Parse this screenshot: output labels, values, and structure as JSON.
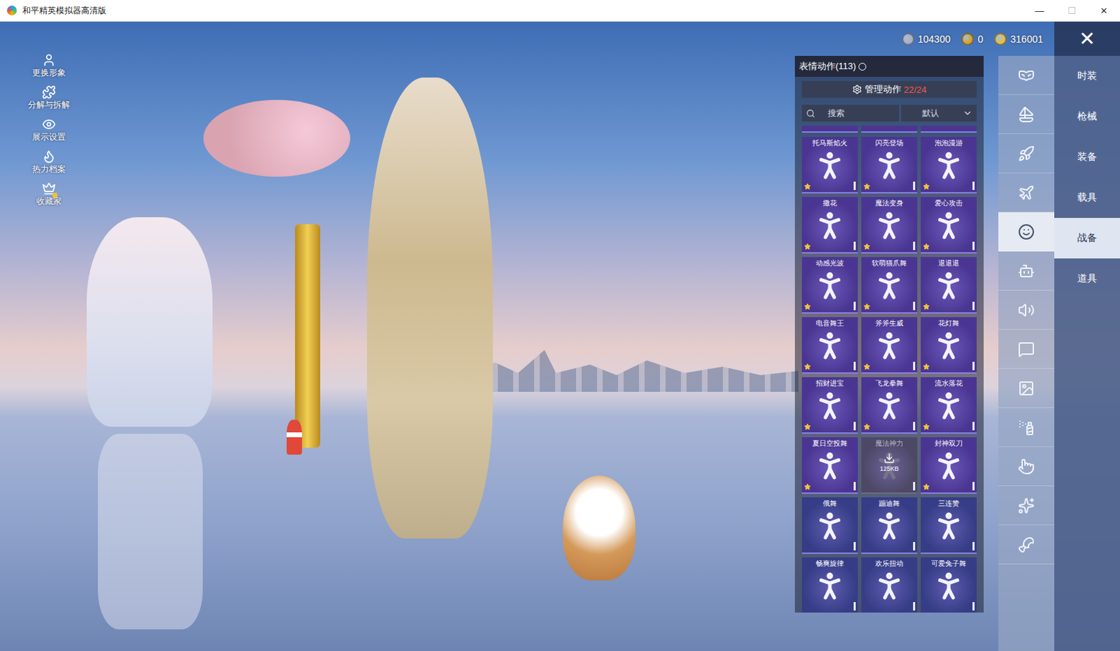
{
  "window": {
    "title": "和平精英模拟器高清版",
    "controls": [
      "—",
      "☐",
      "✕"
    ]
  },
  "tools": [
    {
      "label": "更换形象",
      "badge": false
    },
    {
      "label": "分解与拆解",
      "badge": false
    },
    {
      "label": "展示设置",
      "badge": false
    },
    {
      "label": "热力档案",
      "badge": false
    },
    {
      "label": "收藏家",
      "badge": true
    }
  ],
  "currencies": [
    {
      "amount": "104300",
      "color": "#a9b0c2"
    },
    {
      "amount": "0",
      "color": "#d9a520"
    },
    {
      "amount": "316001",
      "color": "#e8c040"
    }
  ],
  "close": "✕",
  "emote_panel": {
    "title": "表情动作(113)",
    "manage": {
      "label": "管理动作",
      "count": "22/24"
    },
    "search": {
      "placeholder": "搜索"
    },
    "sort": "默认",
    "hidden_above": 3,
    "emotes": [
      {
        "name": "托马斯焰火",
        "kind": "emote",
        "starred": true,
        "color": "#4a3692"
      },
      {
        "name": "闪亮登场",
        "kind": "emote",
        "starred": true,
        "color": "#4a3692"
      },
      {
        "name": "泡泡漫游",
        "kind": "emote",
        "starred": true,
        "color": "#4a3692"
      },
      {
        "name": "撒花",
        "kind": "emote",
        "starred": true,
        "color": "#4a3692"
      },
      {
        "name": "魔法变身",
        "kind": "emote",
        "starred": true,
        "color": "#4a3692"
      },
      {
        "name": "爱心攻击",
        "kind": "emote",
        "starred": true,
        "color": "#4a3692"
      },
      {
        "name": "动感光波",
        "kind": "emote",
        "starred": true,
        "color": "#4a3692"
      },
      {
        "name": "软萌猫爪舞",
        "kind": "emote",
        "starred": true,
        "color": "#4a3692"
      },
      {
        "name": "退退退",
        "kind": "emote",
        "starred": true,
        "color": "#4a3692"
      },
      {
        "name": "电音舞王",
        "kind": "emote",
        "starred": true,
        "color": "#4a3692"
      },
      {
        "name": "斧斧生威",
        "kind": "emote",
        "starred": true,
        "color": "#4a3692"
      },
      {
        "name": "花灯舞",
        "kind": "emote",
        "starred": true,
        "color": "#4a3692"
      },
      {
        "name": "招财进宝",
        "kind": "emote",
        "starred": true,
        "color": "#4a3692"
      },
      {
        "name": "飞龙拳舞",
        "kind": "emote",
        "starred": true,
        "color": "#4a3692"
      },
      {
        "name": "流水落花",
        "kind": "emote",
        "starred": true,
        "color": "#4a3692"
      },
      {
        "name": "夏日空投舞",
        "kind": "emote",
        "starred": true,
        "color": "#4a3692"
      },
      {
        "name": "魔法神力",
        "kind": "downloading",
        "starred": false,
        "color": "#4d4866",
        "size": "125KB"
      },
      {
        "name": "封神双刀",
        "kind": "emote",
        "starred": true,
        "color": "#4a3692"
      },
      {
        "name": "俄舞",
        "kind": "emote",
        "starred": false,
        "color": "#363d86"
      },
      {
        "name": "蹦迪舞",
        "kind": "emote",
        "starred": false,
        "color": "#363d86"
      },
      {
        "name": "三连赞",
        "kind": "emote",
        "starred": false,
        "color": "#363d86"
      },
      {
        "name": "畅爽旋律",
        "kind": "emote",
        "starred": false,
        "color": "#363d86"
      },
      {
        "name": "欢乐扭动",
        "kind": "emote",
        "starred": false,
        "color": "#363d86"
      },
      {
        "name": "可爱兔子舞",
        "kind": "emote",
        "starred": false,
        "color": "#363d86"
      }
    ]
  },
  "icon_rail": [
    {
      "selected": false
    },
    {
      "selected": false
    },
    {
      "selected": false
    },
    {
      "selected": false
    },
    {
      "selected": true
    },
    {
      "selected": false
    },
    {
      "selected": false
    },
    {
      "selected": false
    },
    {
      "selected": false
    },
    {
      "selected": false
    },
    {
      "selected": false
    },
    {
      "selected": false
    },
    {
      "selected": false
    }
  ],
  "tabs": [
    {
      "label": "时装",
      "selected": false
    },
    {
      "label": "枪械",
      "selected": false
    },
    {
      "label": "装备",
      "selected": false
    },
    {
      "label": "载具",
      "selected": false
    },
    {
      "label": "战备",
      "selected": true
    },
    {
      "label": "道具",
      "selected": false
    }
  ]
}
